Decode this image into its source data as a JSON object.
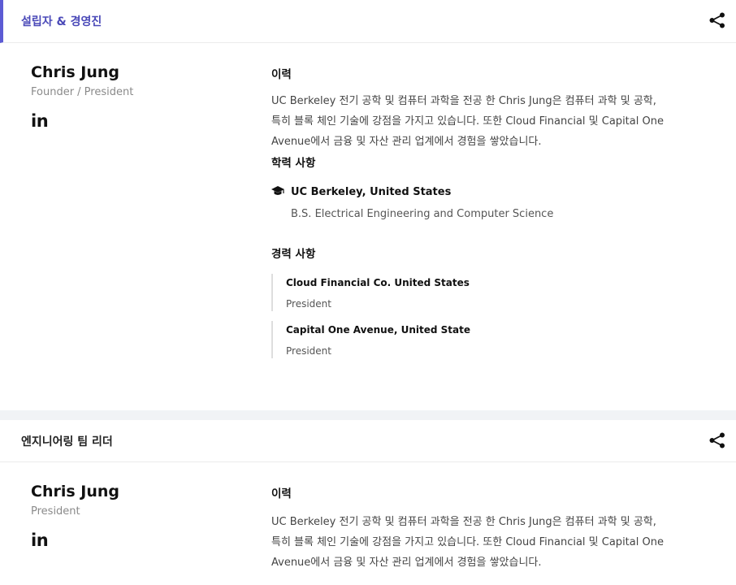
{
  "sections": [
    {
      "title": "설립자 & 경영진",
      "person": {
        "name": "Chris Jung",
        "role": "Founder / President",
        "linkedin": "in"
      },
      "bio_heading": "이력",
      "bio_lines": [
        "UC Berkeley 전기 공학 및 컴퓨터 과학을 전공 한 Chris Jung은 컴퓨터 과학 및 공학,",
        "특히 블록 체인 기술에 강점을 가지고 있습니다. 또한 Cloud Financial 및 Capital One",
        "Avenue에서 금융 및 자산 관리 업계에서 경험을 쌓았습니다."
      ],
      "education_heading": "학력 사항",
      "education": {
        "school": "UC Berkeley, United States",
        "degree": "B.S. Electrical Engineering and Computer Science",
        "icon": "graduation-cap-icon"
      },
      "career_heading": "경력 사항",
      "career": [
        {
          "company": "Cloud Financial Co. United States",
          "role": "President"
        },
        {
          "company": "Capital One Avenue, United State",
          "role": "President"
        }
      ]
    },
    {
      "title": "엔지니어링 팀 리더",
      "person": {
        "name": "Chris Jung",
        "role": "President",
        "linkedin": "in"
      },
      "bio_heading": "이력",
      "bio_lines": [
        "UC Berkeley 전기 공학 및 컴퓨터 과학을 전공 한 Chris Jung은 컴퓨터 과학 및 공학,",
        "특히 블록 체인 기술에 강점을 가지고 있습니다. 또한 Cloud Financial 및 Capital One",
        "Avenue에서 금융 및 자산 관리 업계에서 경험을 쌓았습니다."
      ]
    }
  ],
  "colors": {
    "accent": "#5c5bd4",
    "active_title": "#4a49b8",
    "gap_background": "#f1f3f6"
  },
  "icons": {
    "share": "share-icon",
    "linkedin": "linkedin-icon"
  }
}
